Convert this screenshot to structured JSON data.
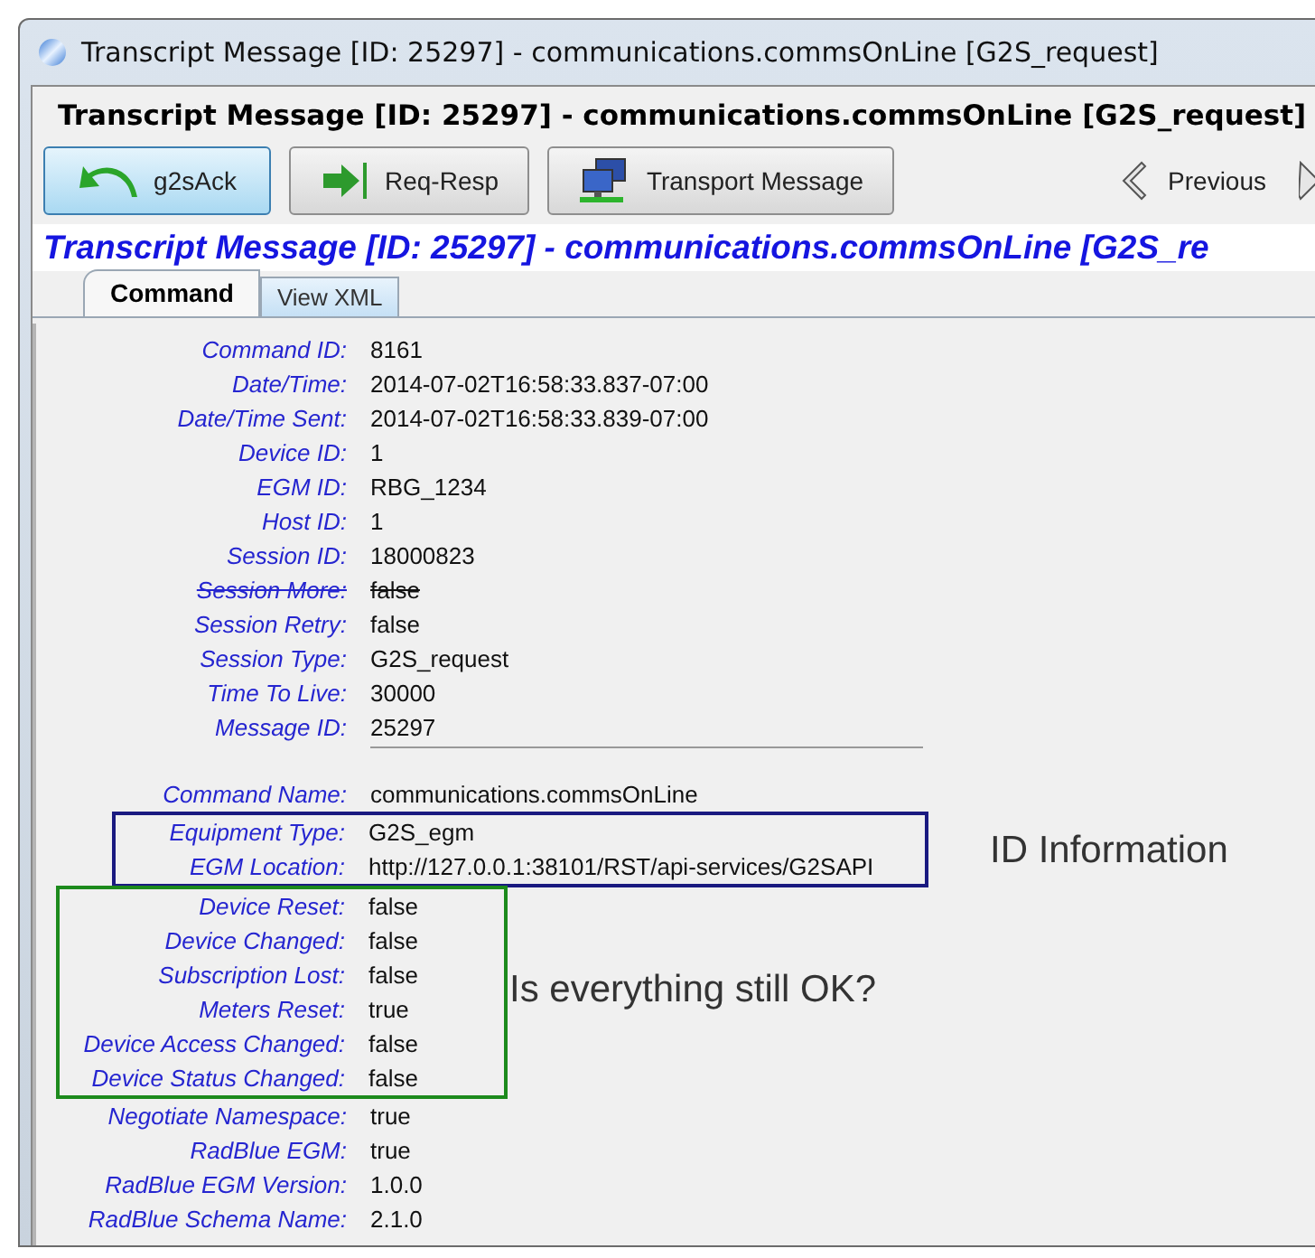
{
  "window": {
    "title": "Transcript Message [ID: 25297] - communications.commsOnLine [G2S_request]"
  },
  "header": "Transcript Message [ID: 25297] - communications.commsOnLine [G2S_request]",
  "toolbar": [
    {
      "label": "g2sAck",
      "kind": "undo",
      "selected": true
    },
    {
      "label": "Req-Resp",
      "kind": "arrow",
      "selected": false
    },
    {
      "label": "Transport Message",
      "kind": "network",
      "selected": false
    }
  ],
  "nav": {
    "label": "Previous"
  },
  "heading": "Transcript Message [ID: 25297] - communications.commsOnLine [G2S_re",
  "tabs": [
    {
      "label": "Command",
      "selected": true
    },
    {
      "label": "View XML",
      "selected": false
    }
  ],
  "groups": [
    {
      "kind": "plain",
      "rule": true,
      "fields": [
        {
          "label": "Command ID:",
          "value": "8161",
          "struck": false
        },
        {
          "label": "Date/Time:",
          "value": "2014-07-02T16:58:33.837-07:00",
          "struck": false
        },
        {
          "label": "Date/Time Sent:",
          "value": "2014-07-02T16:58:33.839-07:00",
          "struck": false
        },
        {
          "label": "Device ID:",
          "value": "1",
          "struck": false
        },
        {
          "label": "EGM ID:",
          "value": "RBG_1234",
          "struck": false
        },
        {
          "label": "Host ID:",
          "value": "1",
          "struck": false
        },
        {
          "label": "Session ID:",
          "value": "18000823",
          "struck": false
        },
        {
          "label": "Session More:",
          "value": "false",
          "struck": true
        },
        {
          "label": "Session Retry:",
          "value": "false",
          "struck": false
        },
        {
          "label": "Session Type:",
          "value": "G2S_request",
          "struck": false
        },
        {
          "label": "Time To Live:",
          "value": "30000",
          "struck": false
        },
        {
          "label": "Message ID:",
          "value": "25297",
          "struck": false
        }
      ]
    },
    {
      "kind": "plain",
      "fields": [
        {
          "label": "Command Name:",
          "value": "communications.commsOnLine",
          "struck": false
        }
      ]
    },
    {
      "kind": "blue",
      "annotation": "ID Information",
      "fields": [
        {
          "label": "Equipment Type:",
          "value": "G2S_egm",
          "struck": false
        },
        {
          "label": "EGM Location:",
          "value": "http://127.0.0.1:38101/RST/api-services/G2SAPI",
          "struck": false
        }
      ]
    },
    {
      "kind": "green",
      "annotation": "Is everything still OK?",
      "fields": [
        {
          "label": "Device Reset:",
          "value": "false",
          "struck": false
        },
        {
          "label": "Device Changed:",
          "value": "false",
          "struck": false
        },
        {
          "label": "Subscription Lost:",
          "value": "false",
          "struck": false
        },
        {
          "label": "Meters Reset:",
          "value": "true",
          "struck": false
        },
        {
          "label": "Device Access Changed:",
          "value": "false",
          "struck": false
        },
        {
          "label": "Device Status Changed:",
          "value": "false",
          "struck": false
        }
      ]
    },
    {
      "kind": "plain",
      "fields": [
        {
          "label": "Negotiate Namespace:",
          "value": "true",
          "struck": false
        },
        {
          "label": "RadBlue EGM:",
          "value": "true",
          "struck": false
        },
        {
          "label": "RadBlue EGM Version:",
          "value": "1.0.0",
          "struck": false
        },
        {
          "label": "RadBlue Schema Name:",
          "value": "2.1.0",
          "struck": false
        }
      ]
    }
  ]
}
